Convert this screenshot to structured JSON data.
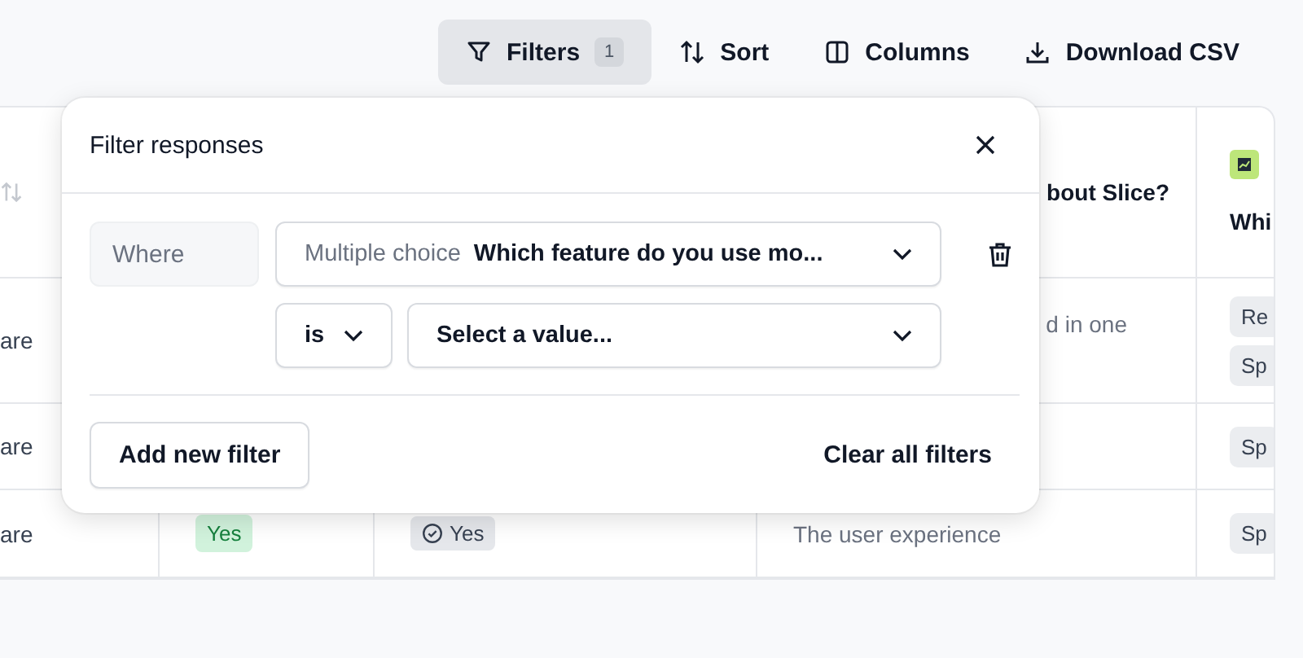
{
  "toolbar": [
    {
      "kind": "filter",
      "label": "Filters",
      "count": "1",
      "selected": true
    },
    {
      "kind": "sort",
      "label": "Sort",
      "selected": false
    },
    {
      "kind": "columns",
      "label": "Columns",
      "selected": false
    },
    {
      "kind": "download",
      "label": "Download CSV",
      "selected": false
    }
  ],
  "table": {
    "columns": [
      {
        "kind": "sort-icon"
      },
      {
        "kind": "blank"
      },
      {
        "kind": "blank"
      },
      {
        "kind": "text",
        "label": "bout Slice?"
      },
      {
        "kind": "badge-icon",
        "label": "Whi"
      }
    ],
    "rows": [
      [
        {
          "kind": "text",
          "text": "are"
        },
        {
          "kind": "empty"
        },
        {
          "kind": "empty"
        },
        {
          "kind": "text",
          "text": "d in one"
        },
        {
          "kind": "tags",
          "tags": [
            "Re",
            "Sp"
          ]
        }
      ],
      [
        {
          "kind": "text",
          "text": "are"
        },
        {
          "kind": "empty"
        },
        {
          "kind": "empty"
        },
        {
          "kind": "empty"
        },
        {
          "kind": "tags",
          "tags": [
            "Sp"
          ]
        }
      ],
      [
        {
          "kind": "text",
          "text": "are"
        },
        {
          "kind": "green-badge",
          "text": "Yes"
        },
        {
          "kind": "check-badge",
          "text": "Yes"
        },
        {
          "kind": "text",
          "text": "The user experience"
        },
        {
          "kind": "tags",
          "tags": [
            "Sp"
          ]
        }
      ]
    ]
  },
  "popover": {
    "title": "Filter responses",
    "filters": [
      {
        "where": "Where",
        "type": "Multiple choice",
        "question": "Which feature do you use mo...",
        "operator": "is",
        "value_placeholder": "Select a value..."
      }
    ],
    "add_button": "Add new filter",
    "clear_button": "Clear all filters"
  }
}
